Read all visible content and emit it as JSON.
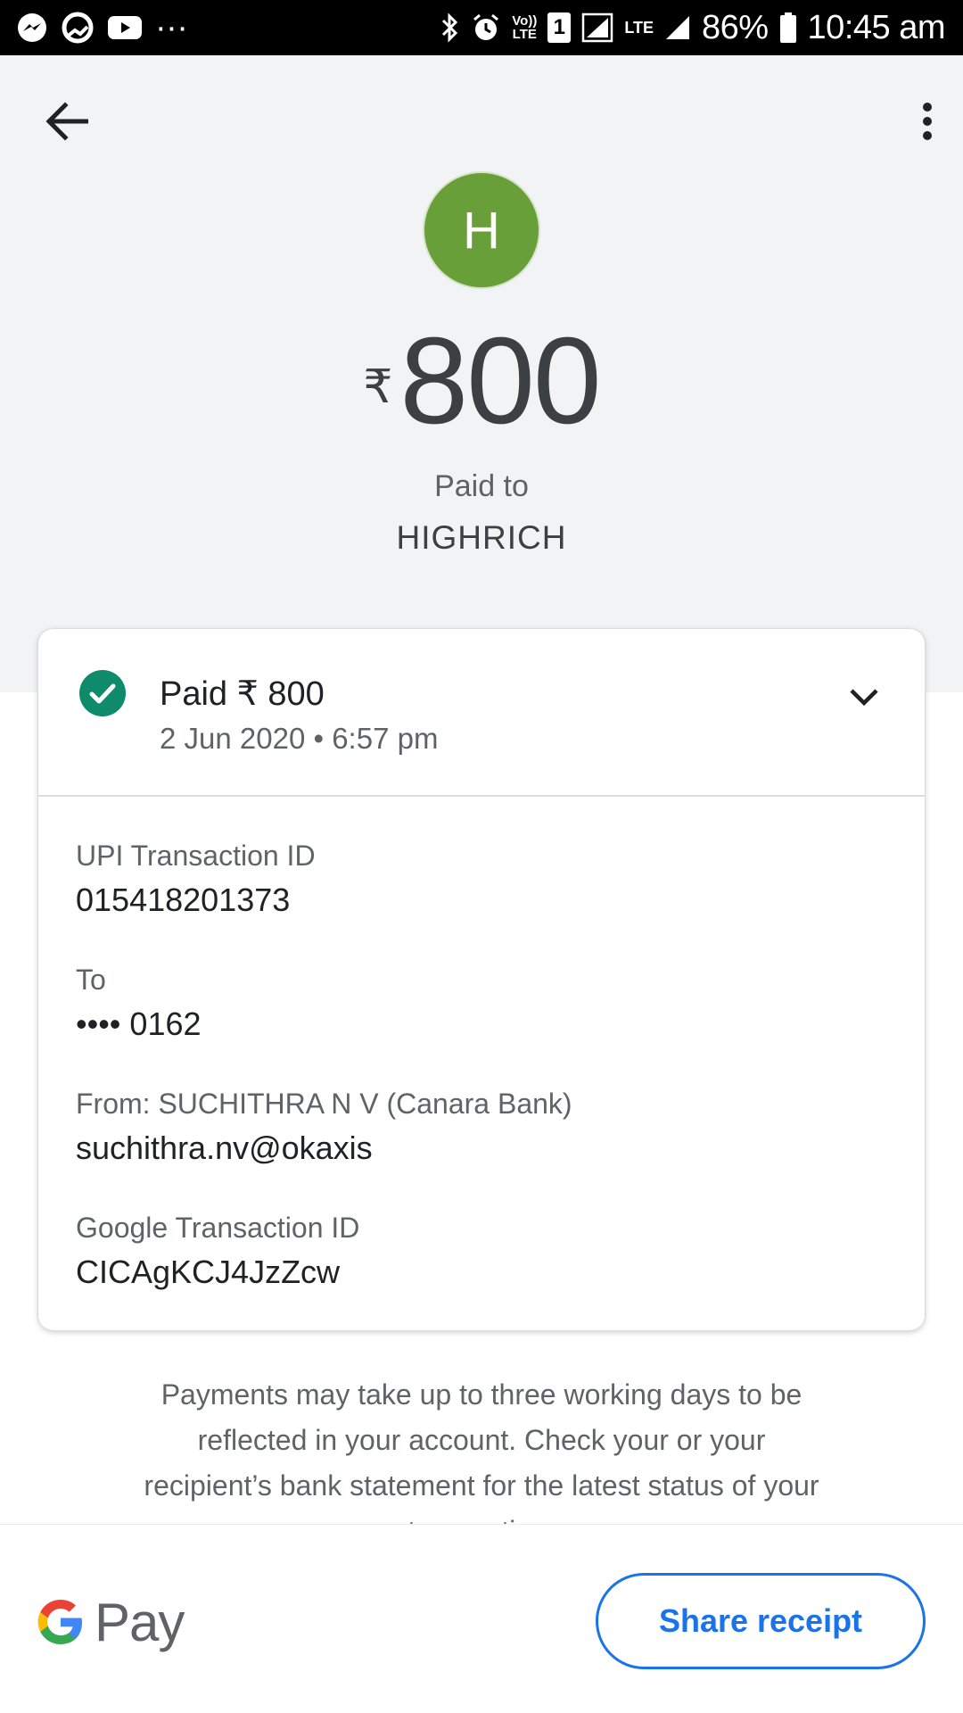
{
  "status_bar": {
    "battery": "86%",
    "time": "10:45 am",
    "volte_line1": "Vo))",
    "volte_line2": "LTE",
    "sim_slot": "1",
    "lte": "LTE",
    "more": "···",
    "icons": [
      "messenger-icon",
      "sync-icon",
      "youtube-icon",
      "bluetooth-icon",
      "alarm-icon",
      "signal-icon",
      "battery-icon"
    ]
  },
  "header": {
    "avatar_initial": "H",
    "avatar_color": "#689f38",
    "currency_symbol": "₹",
    "amount": "800",
    "paid_to_label": "Paid to",
    "payee": "HIGHRICH"
  },
  "card": {
    "status_title": "Paid ₹ 800",
    "status_date": "2 Jun 2020 • 6:57 pm",
    "status_color": "#188038",
    "details": [
      {
        "label": "UPI Transaction ID",
        "value": "015418201373"
      },
      {
        "label": "To",
        "value": "•••• 0162"
      },
      {
        "label": "From: SUCHITHRA N V (Canara Bank)",
        "value": "suchithra.nv@okaxis"
      },
      {
        "label": "Google Transaction ID",
        "value": "CICAgKCJ4JzZcw"
      }
    ]
  },
  "disclaimer": "Payments may take up to three working days to be reflected in your account. Check your or your recipient’s bank statement for the latest status of your transaction.",
  "bottom_bar": {
    "logo_text": "Pay",
    "share_label": "Share receipt",
    "accent_color": "#1a73e8"
  }
}
